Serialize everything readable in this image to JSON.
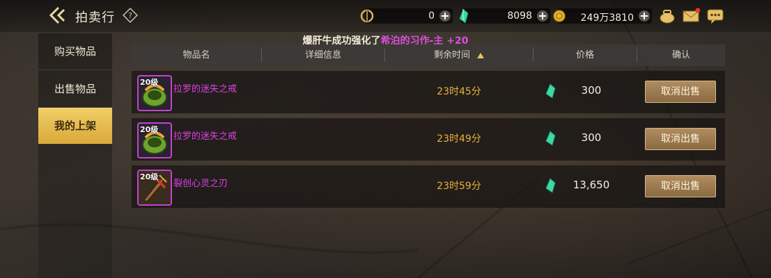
{
  "header": {
    "title": "拍卖行",
    "currencies": [
      {
        "icon": "coupon-coin-icon",
        "value": "0"
      },
      {
        "icon": "green-crystal-icon",
        "value": "8098"
      },
      {
        "icon": "gold-coin-icon",
        "value": "249万3810"
      }
    ],
    "icons": [
      "bag-icon",
      "mail-icon",
      "chat-icon"
    ]
  },
  "notice": {
    "prefix": "爆肝牛成功强化了",
    "item": "希泊的习作-主 +20"
  },
  "sidebar": {
    "items": [
      {
        "label": "购买物品"
      },
      {
        "label": "出售物品"
      },
      {
        "label": "我的上架"
      }
    ],
    "active_index": 2
  },
  "table": {
    "columns": [
      "物品名",
      "详细信息",
      "剩余时间",
      "价格",
      "确认"
    ],
    "sort_column": "剩余时间",
    "rows": [
      {
        "level": "20级",
        "name": "拉罗的迷失之戒",
        "time": "23时45分",
        "price": "300",
        "action": "取消出售",
        "icon": "ring-item-icon"
      },
      {
        "level": "20级",
        "name": "拉罗的迷失之戒",
        "time": "23时49分",
        "price": "300",
        "action": "取消出售",
        "icon": "ring-item-icon"
      },
      {
        "level": "20级",
        "name": "裂创心灵之刃",
        "time": "23时59分",
        "price": "13,650",
        "action": "取消出售",
        "icon": "blade-item-icon"
      }
    ]
  },
  "colors": {
    "accent": "#e7c35a",
    "item_purple": "#e040e6",
    "time_orange": "#eab23c"
  }
}
